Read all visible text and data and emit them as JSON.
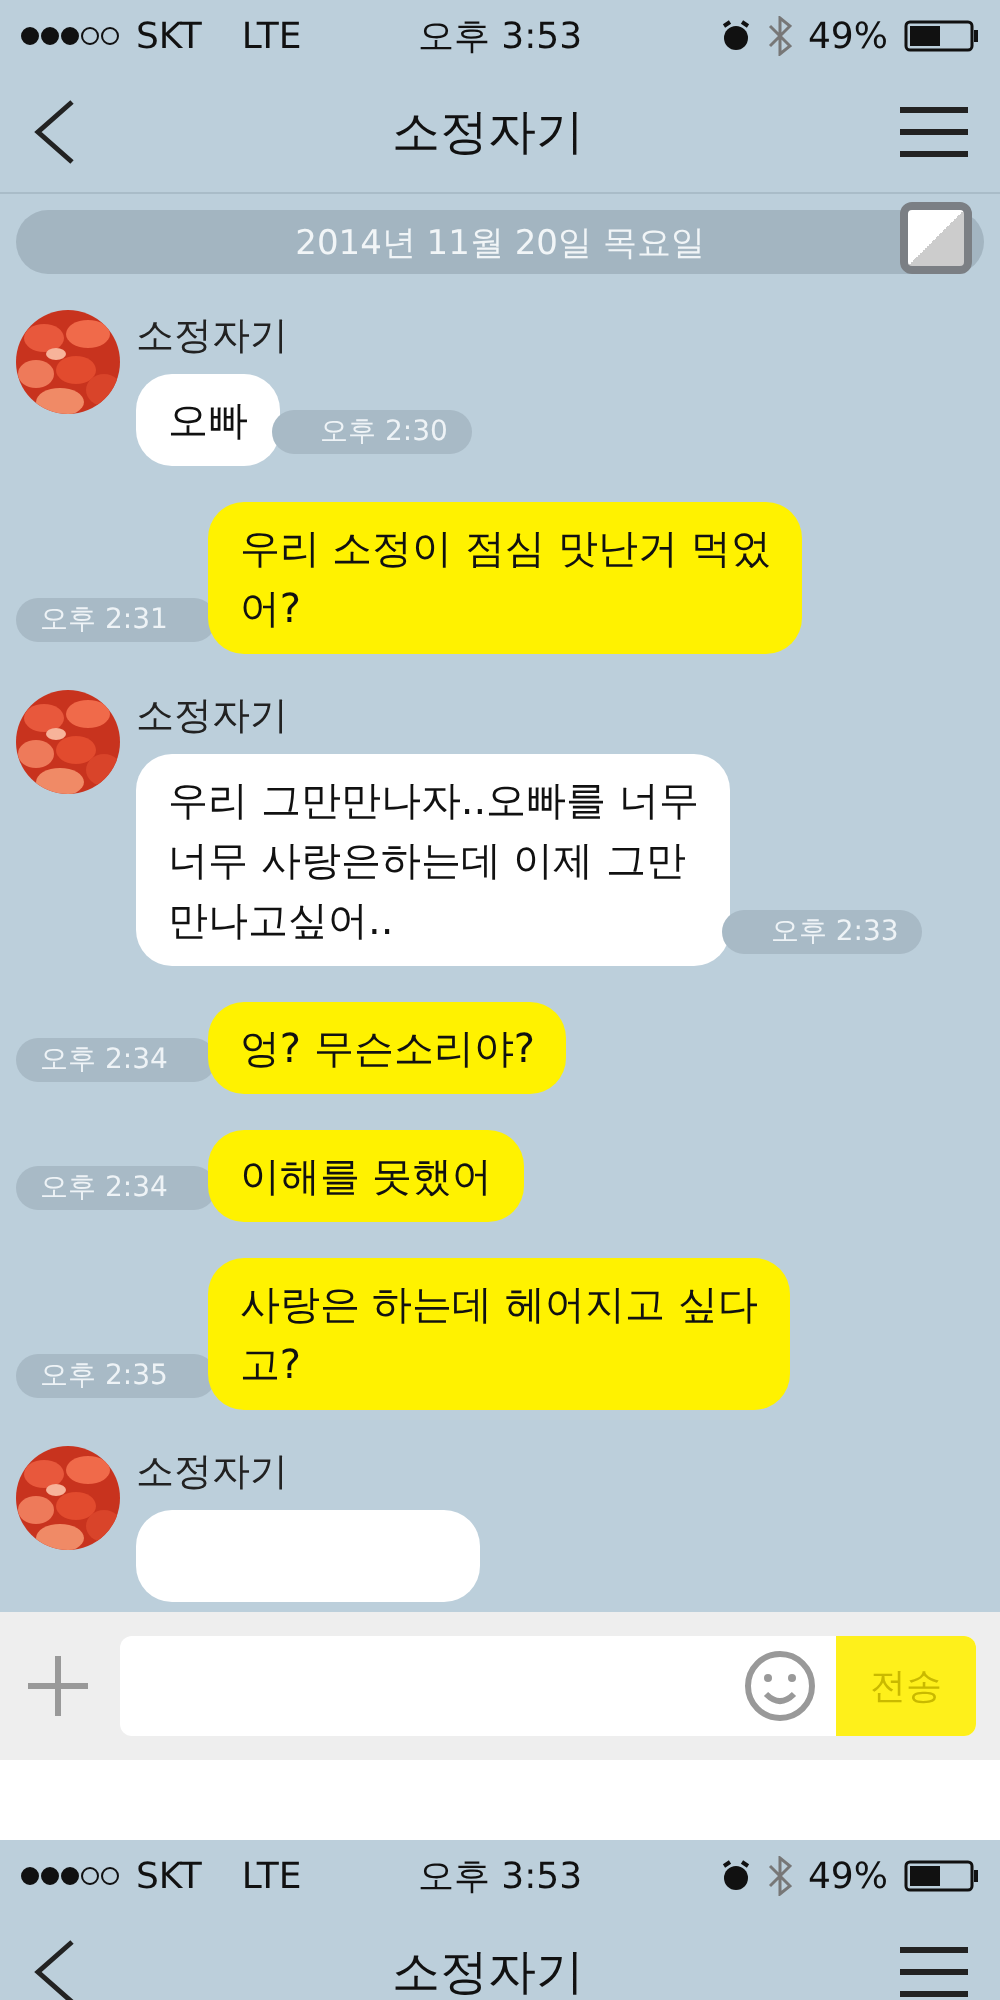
{
  "screens": [
    {
      "status_bar": {
        "carrier": "SKT",
        "network": "LTE",
        "time": "오후 3:53",
        "battery": "49%"
      },
      "header": {
        "title": "소정자기"
      },
      "date_divider": "2014년 11월 20일 목요일",
      "messages": [
        {
          "kind": "received",
          "sender": "소정자기",
          "lines": [
            "오빠"
          ],
          "time": "오후 2:30"
        },
        {
          "kind": "sent",
          "lines": [
            "우리 소정이 점심 맛난거 먹었",
            "어?"
          ],
          "time": "오후 2:31"
        },
        {
          "kind": "received",
          "sender": "소정자기",
          "lines": [
            "우리 그만만나자..오빠를 너무",
            "너무 사랑은하는데 이제 그만",
            "만나고싶어.."
          ],
          "time": "오후 2:33"
        },
        {
          "kind": "sent",
          "lines": [
            "엉? 무슨소리야?"
          ],
          "time": "오후 2:34"
        },
        {
          "kind": "sent",
          "lines": [
            "이해를 못했어"
          ],
          "time": "오후 2:34"
        },
        {
          "kind": "sent",
          "lines": [
            "사랑은 하는데 헤어지고 싶다",
            "고?"
          ],
          "time": "오후 2:35"
        },
        {
          "kind": "received",
          "sender": "소정자기"
        }
      ],
      "composer": {
        "send_label": "전송"
      }
    },
    {
      "status_bar": {
        "carrier": "SKT",
        "network": "LTE",
        "time": "오후 3:53",
        "battery": "49%"
      },
      "header": {
        "title": "소정자기"
      }
    }
  ]
}
